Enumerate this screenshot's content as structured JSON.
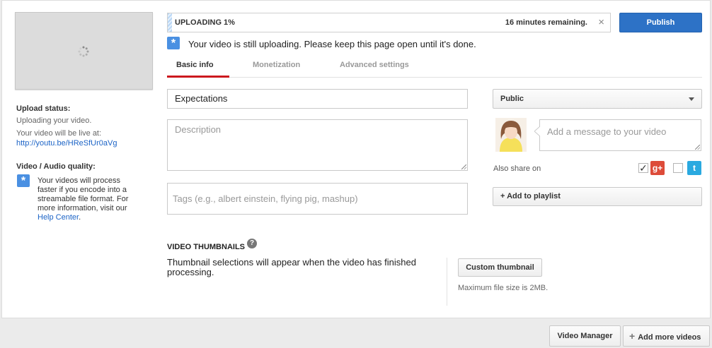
{
  "upload": {
    "status_label": "UPLOADING 1%",
    "progress_fraction": 0.01,
    "remaining": "16 minutes remaining.",
    "close_glyph": "×"
  },
  "publish_label": "Publish",
  "notice": {
    "icon": "star-info-icon",
    "text": "Your video is still uploading. Please keep this page open until it's done."
  },
  "tabs": [
    {
      "label": "Basic info",
      "active": true
    },
    {
      "label": "Monetization",
      "active": false
    },
    {
      "label": "Advanced settings",
      "active": false
    }
  ],
  "sidebar": {
    "upload_status_title": "Upload status:",
    "upload_status_text": "Uploading your video.",
    "live_at_text": "Your video will be live at:",
    "video_link": "http://youtu.be/HReSfUr0aVg",
    "quality_title": "Video / Audio quality:",
    "quality_text": "Your videos will process faster if you encode into a streamable file format. For more information, visit our",
    "help_center_link": "Help Center",
    "period": "."
  },
  "form": {
    "title_value": "Expectations",
    "description_placeholder": "Description",
    "tags_placeholder": "Tags (e.g., albert einstein, flying pig, mashup)"
  },
  "privacy": {
    "selected": "Public"
  },
  "share": {
    "message_placeholder": "Add a message to your video",
    "also_share_label": "Also share on",
    "gplus_checked": true,
    "twitter_checked": false,
    "gplus_glyph": "g+",
    "twitter_glyph": "t",
    "check_glyph": "✓",
    "gplus_color": "#dd4b39",
    "twitter_color": "#2aa9e0"
  },
  "playlist_label": "+ Add to playlist",
  "thumbnails": {
    "title": "VIDEO THUMBNAILS",
    "help_glyph": "?",
    "message": "Thumbnail selections will appear when the video has finished processing.",
    "custom_button": "Custom thumbnail",
    "max_size": "Maximum file size is 2MB."
  },
  "footer": {
    "video_manager": "Video Manager",
    "add_more_plus": "+",
    "add_more_videos": "Add more videos"
  },
  "colors": {
    "accent_blue": "#2d72c6",
    "tab_red": "#cc181e",
    "link_blue": "#1b63c6"
  }
}
